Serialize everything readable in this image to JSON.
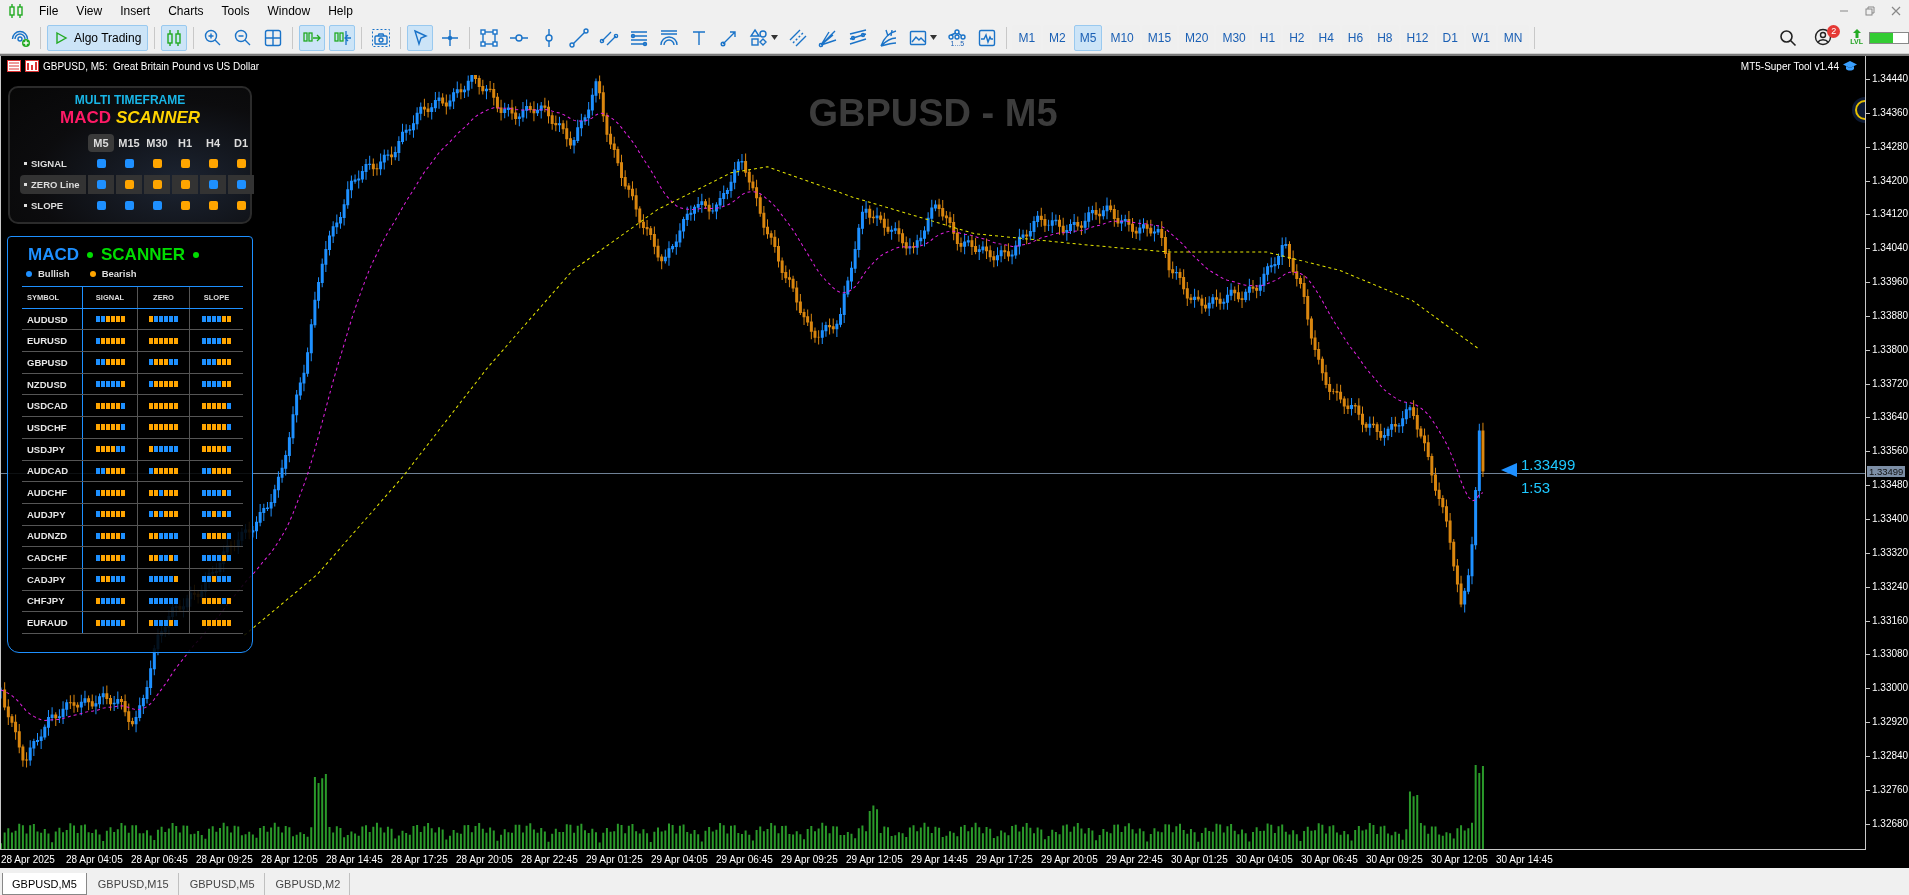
{
  "menu": [
    "File",
    "View",
    "Insert",
    "Charts",
    "Tools",
    "Window",
    "Help"
  ],
  "tools": [
    {
      "kind": "signals",
      "selected": false
    },
    {
      "kind": "separator"
    },
    {
      "kind": "algo",
      "label": "Algo Trading",
      "selected": true
    },
    {
      "kind": "separator"
    },
    {
      "kind": "candles",
      "selected": true
    },
    {
      "kind": "separator"
    },
    {
      "kind": "zoom_in",
      "selected": false
    },
    {
      "kind": "zoom_out",
      "selected": false
    },
    {
      "kind": "tile",
      "selected": false
    },
    {
      "kind": "separator"
    },
    {
      "kind": "autoscroll",
      "selected": true
    },
    {
      "kind": "shift",
      "selected": true
    },
    {
      "kind": "separator"
    },
    {
      "kind": "screenshot",
      "selected": false
    },
    {
      "kind": "separator"
    },
    {
      "kind": "cursor",
      "selected": true
    },
    {
      "kind": "crosshair",
      "selected": false
    },
    {
      "kind": "separator"
    },
    {
      "kind": "rectangle",
      "selected": false
    },
    {
      "kind": "hline",
      "selected": false
    },
    {
      "kind": "vline",
      "selected": false
    },
    {
      "kind": "trendline",
      "selected": false
    },
    {
      "kind": "channel",
      "selected": false
    },
    {
      "kind": "levels",
      "selected": false
    },
    {
      "kind": "arcs",
      "selected": false
    },
    {
      "kind": "text",
      "selected": false
    },
    {
      "kind": "arrow",
      "selected": false
    },
    {
      "kind": "shapes",
      "selected": false,
      "dropdown": true
    },
    {
      "kind": "parallel",
      "selected": false
    },
    {
      "kind": "fan",
      "selected": false
    },
    {
      "kind": "lines",
      "selected": false
    },
    {
      "kind": "fan2",
      "selected": false
    },
    {
      "kind": "image",
      "selected": false,
      "dropdown": true
    },
    {
      "kind": "waves",
      "label": "1...5",
      "selected": false
    },
    {
      "kind": "monitor",
      "selected": false
    },
    {
      "kind": "separator"
    }
  ],
  "timeframes": [
    {
      "label": "M1",
      "selected": false
    },
    {
      "label": "M2",
      "selected": false
    },
    {
      "label": "M5",
      "selected": true
    },
    {
      "label": "M10",
      "selected": false
    },
    {
      "label": "M15",
      "selected": false
    },
    {
      "label": "M20",
      "selected": false
    },
    {
      "label": "M30",
      "selected": false
    },
    {
      "label": "H1",
      "selected": false
    },
    {
      "label": "H2",
      "selected": false
    },
    {
      "label": "H4",
      "selected": false
    },
    {
      "label": "H6",
      "selected": false
    },
    {
      "label": "H8",
      "selected": false
    },
    {
      "label": "H12",
      "selected": false
    },
    {
      "label": "D1",
      "selected": false
    },
    {
      "label": "W1",
      "selected": false
    },
    {
      "label": "MN",
      "selected": false
    }
  ],
  "status": {
    "notifications": "2",
    "level_badge": "LVL",
    "level": 0.6
  },
  "chart": {
    "title": "GBPUSD, M5:  Great Britain Pound vs US Dollar",
    "tool_label": "MT5-Super Tool v1.44",
    "symbol_caption": "GBPUSD - M5",
    "price_label": "1.33499",
    "countdown": "1:53",
    "bid_tag": "1.33499",
    "price_axis": [
      "1.34440",
      "1.34360",
      "1.34280",
      "1.34200",
      "1.34120",
      "1.34040",
      "1.33960",
      "1.33880",
      "1.33800",
      "1.33720",
      "1.33640",
      "1.33560",
      "1.33480",
      "1.33400",
      "1.33320",
      "1.33240",
      "1.33160",
      "1.33080",
      "1.33000",
      "1.32920",
      "1.32840",
      "1.32760",
      "1.32680"
    ],
    "time_axis": [
      "28 Apr 2025",
      "28 Apr 04:05",
      "28 Apr 06:45",
      "28 Apr 09:25",
      "28 Apr 12:05",
      "28 Apr 14:45",
      "28 Apr 17:25",
      "28 Apr 20:05",
      "28 Apr 22:45",
      "29 Apr 01:25",
      "29 Apr 04:05",
      "29 Apr 06:45",
      "29 Apr 09:25",
      "29 Apr 12:05",
      "29 Apr 14:45",
      "29 Apr 17:25",
      "29 Apr 20:05",
      "29 Apr 22:45",
      "30 Apr 01:25",
      "30 Apr 04:05",
      "30 Apr 06:45",
      "30 Apr 09:25",
      "30 Apr 12:05",
      "30 Apr 14:45"
    ]
  },
  "mtf_panel": {
    "title": "MULTI TIMEFRAME",
    "title_main": "MACD",
    "title_accent": "SCANNER",
    "timeframes": [
      {
        "label": "M5",
        "selected": true
      },
      {
        "label": "M15",
        "selected": false
      },
      {
        "label": "M30",
        "selected": false
      },
      {
        "label": "H1",
        "selected": false
      },
      {
        "label": "H4",
        "selected": false
      },
      {
        "label": "D1",
        "selected": false
      }
    ],
    "rows": [
      {
        "label": "SIGNAL",
        "selected": false,
        "bullish": [
          true,
          true,
          false,
          false,
          false,
          false
        ]
      },
      {
        "label": "ZERO Line",
        "selected": true,
        "bullish": [
          true,
          false,
          false,
          false,
          true,
          true
        ]
      },
      {
        "label": "SLOPE",
        "selected": false,
        "bullish": [
          true,
          true,
          true,
          false,
          false,
          false
        ]
      }
    ]
  },
  "scanner": {
    "title": "MACD",
    "title_accent": "SCANNER",
    "legend": [
      {
        "label": "Bullish",
        "color": "#1e90ff"
      },
      {
        "label": "Bearish",
        "color": "#ffa500"
      }
    ],
    "columns": [
      "SYMBOL",
      "SIGNAL",
      "ZERO",
      "SLOPE"
    ],
    "rows": [
      {
        "symbol": "AUDUSD",
        "signal": [
          true,
          true,
          false,
          false,
          false,
          false
        ],
        "zero": [
          false,
          true,
          true,
          true,
          true,
          true
        ],
        "slope": [
          true,
          true,
          true,
          true,
          false,
          false
        ]
      },
      {
        "symbol": "EURUSD",
        "signal": [
          true,
          false,
          false,
          false,
          false,
          false
        ],
        "zero": [
          false,
          false,
          false,
          false,
          false,
          false
        ],
        "slope": [
          true,
          true,
          true,
          true,
          false,
          false
        ]
      },
      {
        "symbol": "GBPUSD",
        "signal": [
          true,
          true,
          false,
          false,
          false,
          false
        ],
        "zero": [
          true,
          false,
          false,
          false,
          true,
          true
        ],
        "slope": [
          true,
          true,
          true,
          false,
          false,
          false
        ]
      },
      {
        "symbol": "NZDUSD",
        "signal": [
          true,
          true,
          true,
          true,
          true,
          false
        ],
        "zero": [
          true,
          false,
          false,
          false,
          false,
          false
        ],
        "slope": [
          true,
          true,
          true,
          true,
          false,
          false
        ]
      },
      {
        "symbol": "USDCAD",
        "signal": [
          false,
          false,
          false,
          false,
          false,
          true
        ],
        "zero": [
          false,
          false,
          false,
          false,
          false,
          false
        ],
        "slope": [
          false,
          false,
          false,
          false,
          false,
          true
        ]
      },
      {
        "symbol": "USDCHF",
        "signal": [
          false,
          false,
          false,
          false,
          false,
          true
        ],
        "zero": [
          false,
          false,
          false,
          false,
          false,
          false
        ],
        "slope": [
          false,
          false,
          false,
          false,
          false,
          true
        ]
      },
      {
        "symbol": "USDJPY",
        "signal": [
          false,
          false,
          false,
          false,
          true,
          true
        ],
        "zero": [
          false,
          true,
          true,
          true,
          true,
          true
        ],
        "slope": [
          false,
          false,
          false,
          false,
          false,
          true
        ]
      },
      {
        "symbol": "AUDCAD",
        "signal": [
          true,
          true,
          false,
          false,
          false,
          false
        ],
        "zero": [
          true,
          false,
          false,
          false,
          false,
          false
        ],
        "slope": [
          true,
          true,
          false,
          false,
          false,
          false
        ]
      },
      {
        "symbol": "AUDCHF",
        "signal": [
          true,
          false,
          false,
          false,
          false,
          false
        ],
        "zero": [
          false,
          false,
          true,
          false,
          false,
          false
        ],
        "slope": [
          true,
          true,
          true,
          true,
          false,
          true
        ]
      },
      {
        "symbol": "AUDJPY",
        "signal": [
          true,
          false,
          false,
          false,
          false,
          false
        ],
        "zero": [
          true,
          false,
          true,
          false,
          false,
          false
        ],
        "slope": [
          true,
          true,
          false,
          true,
          false,
          true
        ]
      },
      {
        "symbol": "AUDNZD",
        "signal": [
          true,
          false,
          false,
          false,
          false,
          true
        ],
        "zero": [
          false,
          false,
          true,
          true,
          true,
          true
        ],
        "slope": [
          true,
          false,
          false,
          false,
          false,
          true
        ]
      },
      {
        "symbol": "CADCHF",
        "signal": [
          true,
          false,
          false,
          false,
          false,
          true
        ],
        "zero": [
          false,
          false,
          true,
          true,
          false,
          true
        ],
        "slope": [
          true,
          true,
          true,
          true,
          false,
          true
        ]
      },
      {
        "symbol": "CADJPY",
        "signal": [
          true,
          false,
          false,
          true,
          true,
          true
        ],
        "zero": [
          true,
          true,
          true,
          true,
          true,
          false
        ],
        "slope": [
          true,
          true,
          false,
          true,
          true,
          true
        ]
      },
      {
        "symbol": "CHFJPY",
        "signal": [
          false,
          true,
          true,
          true,
          true,
          false
        ],
        "zero": [
          true,
          true,
          true,
          true,
          true,
          true
        ],
        "slope": [
          false,
          false,
          false,
          false,
          true,
          false
        ]
      },
      {
        "symbol": "EURAUD",
        "signal": [
          false,
          true,
          true,
          true,
          true,
          false
        ],
        "zero": [
          false,
          true,
          true,
          true,
          false,
          true
        ],
        "slope": [
          false,
          false,
          false,
          false,
          false,
          false
        ]
      }
    ]
  },
  "tabs": [
    {
      "label": "GBPUSD,M5",
      "selected": true
    },
    {
      "label": "GBPUSD,M15",
      "selected": false
    },
    {
      "label": "GBPUSD,M5",
      "selected": false
    },
    {
      "label": "GBPUSD,M2",
      "selected": false
    }
  ]
}
